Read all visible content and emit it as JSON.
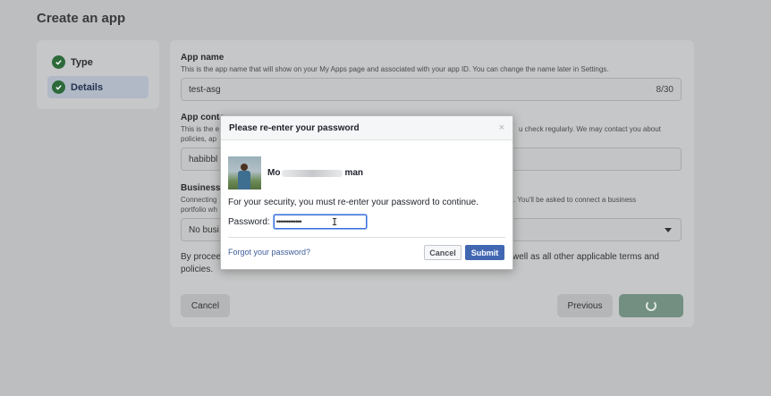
{
  "page": {
    "title": "Create an app"
  },
  "steps": [
    {
      "label": "Type",
      "icon": "check-circle-icon"
    },
    {
      "label": "Details",
      "icon": "check-circle-icon"
    }
  ],
  "form": {
    "app_name": {
      "label": "App name",
      "help": "This is the app name that will show on your My Apps page and associated with your app ID. You can change the name later in Settings.",
      "value": "test-asg",
      "counter": "8/30"
    },
    "contact": {
      "label": "App conta",
      "help_line1": "This is the e",
      "help_line1_right": "u check regularly. We may contact you about",
      "help_line2": "policies, ap",
      "value": "habibbl"
    },
    "business": {
      "label": "Business",
      "help_line1": "Connecting",
      "help_line1_right": "s. You'll be asked to connect a business",
      "help_line2": "portfolio wh",
      "value": "No busi"
    },
    "terms_line1_left": "By procee",
    "terms_line1_right": "well as all other applicable terms and",
    "terms_line2": "policies.",
    "cancel_label": "Cancel",
    "previous_label": "Previous"
  },
  "dialog": {
    "title": "Please re-enter your password",
    "close": "×",
    "user_name_start": "Mo",
    "user_name_end": "man",
    "security_text": "For your security, you must re-enter your password to continue.",
    "password_label": "Password:",
    "password_value": "•••••••••••••",
    "forgot_link": "Forgot your password?",
    "cancel_label": "Cancel",
    "submit_label": "Submit"
  },
  "colors": {
    "overlay": "#bdbebf",
    "submit": "#4267b2",
    "link": "#3d5b99",
    "step_check": "#2d6a3b"
  }
}
